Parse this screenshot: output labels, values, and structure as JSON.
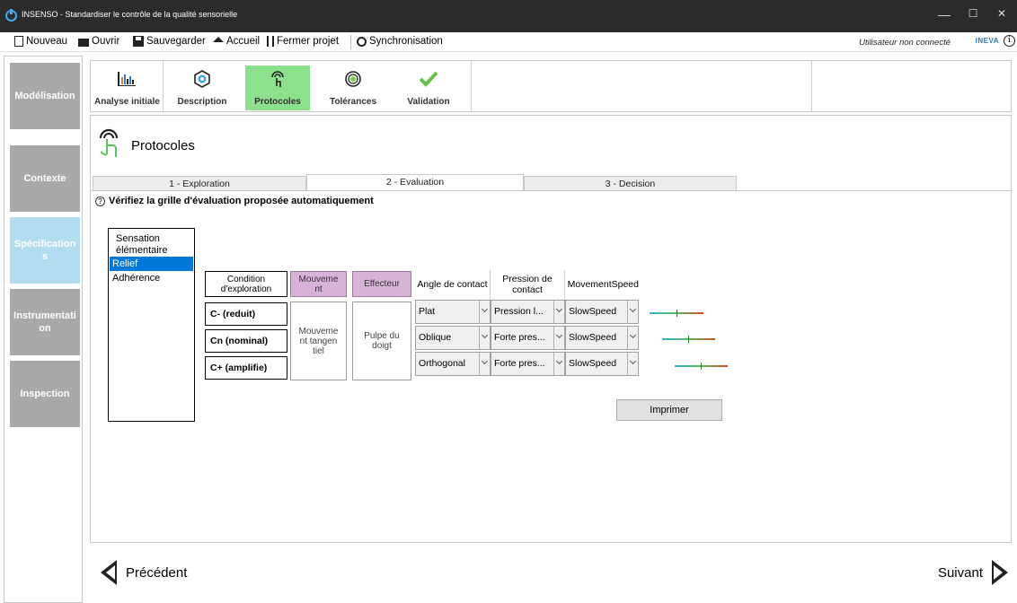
{
  "window": {
    "title": "INSENSO - Standardiser le contrôle de la qualité sensorielle",
    "minimize": "—",
    "maximize": "☐",
    "close": "✕"
  },
  "menu": {
    "items": [
      {
        "label": "Nouveau",
        "icon": "new-document-icon"
      },
      {
        "label": "Ouvrir",
        "icon": "folder-open-icon"
      },
      {
        "label": "Sauvegarder",
        "icon": "save-icon"
      },
      {
        "label": "Accueil",
        "icon": "home-icon"
      },
      {
        "label": "Fermer projet",
        "icon": "close-project-icon"
      },
      {
        "label": "Synchronisation",
        "icon": "sync-icon"
      }
    ],
    "user_status": "Utilisateur non connecté",
    "logo": "INEVA",
    "info": "i"
  },
  "sidebar": {
    "items": [
      {
        "label": "Modélisation",
        "active": false
      },
      {
        "label": "Contexte",
        "active": false
      },
      {
        "label": "Spécifications",
        "active": true
      },
      {
        "label": "Instrumentation",
        "active": false
      },
      {
        "label": "Inspection",
        "active": false
      }
    ]
  },
  "ribbon": {
    "buttons": [
      {
        "label": "Analyse initiale",
        "icon": "bar-chart-icon",
        "active": false
      },
      {
        "label": "Description",
        "icon": "description-icon",
        "active": false
      },
      {
        "label": "Protocoles",
        "icon": "touch-finger-icon",
        "active": true
      },
      {
        "label": "Tolérances",
        "icon": "target-icon",
        "active": false
      },
      {
        "label": "Validation",
        "icon": "checkmark-icon",
        "active": false
      }
    ]
  },
  "page": {
    "title": "Protocoles"
  },
  "tabs": [
    {
      "label": "1 - Exploration",
      "active": false
    },
    {
      "label": "2 - Evaluation",
      "active": true
    },
    {
      "label": "3 - Decision",
      "active": false
    }
  ],
  "instruction": {
    "icon": "?",
    "text": "Vérifiez la grille d'évaluation proposée automatiquement"
  },
  "sensation_list": {
    "header": "Sensation élémentaire",
    "items": [
      {
        "label": "Relief",
        "selected": true
      },
      {
        "label": "Adhérence",
        "selected": false
      }
    ]
  },
  "grid": {
    "condition_header": "Condition d'exploration",
    "movement_header": "Mouvement",
    "effector_header": "Effecteur",
    "conditions": [
      "C- (reduit)",
      "Cn (nominal)",
      "C+ (amplifie)"
    ],
    "movement_value": "Mouvement tangentiel",
    "effector_value": "Pulpe du doigt"
  },
  "data_grid": {
    "columns": [
      "Angle de contact",
      "Pression de contact",
      "MovementSpeed"
    ],
    "rows": [
      [
        "Plat",
        "Pression l...",
        "SlowSpeed"
      ],
      [
        "Oblique",
        "Forte pres...",
        "SlowSpeed"
      ],
      [
        "Orthogonal",
        "Forte pres...",
        "SlowSpeed"
      ]
    ]
  },
  "print_button": "Imprimer",
  "navigation": {
    "previous": "Précédent",
    "next": "Suivant"
  }
}
